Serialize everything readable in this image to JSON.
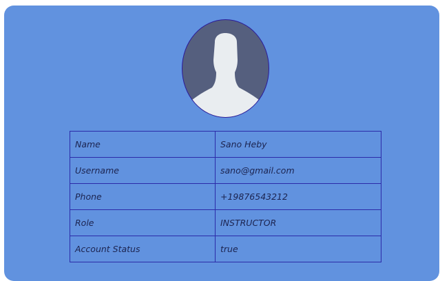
{
  "profile": {
    "avatar_icon": "user-silhouette-icon",
    "rows": [
      {
        "label": "Name",
        "value": "Sano Heby"
      },
      {
        "label": "Username",
        "value": "sano@gmail.com"
      },
      {
        "label": "Phone",
        "value": "+19876543212"
      },
      {
        "label": "Role",
        "value": "INSTRUCTOR"
      },
      {
        "label": "Account Status",
        "value": "true"
      }
    ]
  },
  "colors": {
    "card_background": "#6192df",
    "border": "#2b2aa8",
    "avatar_background": "#555f7e",
    "silhouette": "#e9edf0"
  }
}
